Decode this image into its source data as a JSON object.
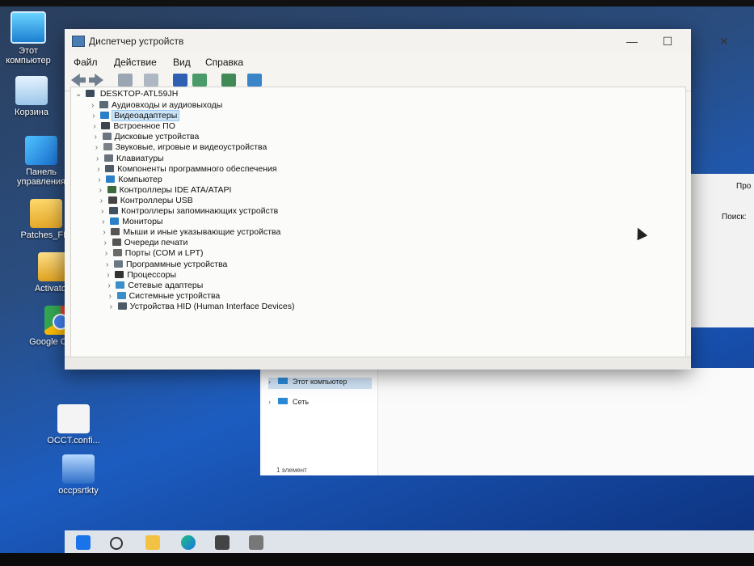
{
  "desktop": {
    "icons": [
      {
        "label": "Этот компьютер",
        "icon": "computer-icon"
      },
      {
        "label": "Корзина",
        "icon": "recycle-bin-icon"
      },
      {
        "label": "Панель управления",
        "icon": "control-panel-icon"
      },
      {
        "label": "Patches_FIX",
        "icon": "folder-icon"
      },
      {
        "label": "Activators",
        "icon": "key-icon"
      },
      {
        "label": "Google Chrome",
        "icon": "chrome-icon"
      },
      {
        "label": "OCCT.confi...",
        "icon": "document-icon"
      },
      {
        "label": "occpsrtkty",
        "icon": "occt-icon"
      }
    ]
  },
  "window": {
    "title": "Диспетчер устройств",
    "menu": [
      "Файл",
      "Действие",
      "Вид",
      "Справка"
    ],
    "controls": {
      "minimize": "—",
      "maximize": "☐",
      "close": "✕"
    },
    "toolbar": [
      "back-icon",
      "forward-icon",
      "properties-icon",
      "show-hidden-icon",
      "help-icon",
      "update-driver-icon",
      "scan-icon",
      "monitor-icon"
    ],
    "root": "DESKTOP-ATL59JH",
    "devices": [
      {
        "label": "Аудиовходы и аудиовыходы",
        "icon": "audio-icon"
      },
      {
        "label": "Видеоадаптеры",
        "icon": "display-adapter-icon",
        "selected": true
      },
      {
        "label": "Встроенное ПО",
        "icon": "firmware-icon"
      },
      {
        "label": "Дисковые устройства",
        "icon": "disk-icon"
      },
      {
        "label": "Звуковые, игровые и видеоустройства",
        "icon": "speaker-icon"
      },
      {
        "label": "Клавиатуры",
        "icon": "keyboard-icon"
      },
      {
        "label": "Компоненты программного обеспечения",
        "icon": "software-component-icon"
      },
      {
        "label": "Компьютер",
        "icon": "computer-icon"
      },
      {
        "label": "Контроллеры IDE ATA/ATAPI",
        "icon": "ide-controller-icon"
      },
      {
        "label": "Контроллеры USB",
        "icon": "usb-icon"
      },
      {
        "label": "Контроллеры запоминающих устройств",
        "icon": "storage-controller-icon"
      },
      {
        "label": "Мониторы",
        "icon": "monitor-icon"
      },
      {
        "label": "Мыши и иные указывающие устройства",
        "icon": "mouse-icon"
      },
      {
        "label": "Очереди печати",
        "icon": "printer-icon"
      },
      {
        "label": "Порты (COM и LPT)",
        "icon": "port-icon"
      },
      {
        "label": "Программные устройства",
        "icon": "software-device-icon"
      },
      {
        "label": "Процессоры",
        "icon": "processor-icon"
      },
      {
        "label": "Сетевые адаптеры",
        "icon": "network-adapter-icon"
      },
      {
        "label": "Системные устройства",
        "icon": "system-device-icon"
      },
      {
        "label": "Устройства HID (Human Interface Devices)",
        "icon": "hid-icon"
      }
    ]
  },
  "explorer": {
    "items": [
      {
        "label": "Этот компьютер",
        "icon": "computer-icon"
      },
      {
        "label": "Сеть",
        "icon": "network-icon"
      }
    ],
    "status": "1 элемент"
  },
  "side_panel": {
    "line1": "Про",
    "line2": "Поиск:"
  },
  "taskbar": [
    "start-icon",
    "search-icon",
    "file-explorer-icon",
    "edge-icon",
    "store-icon",
    "app-icon"
  ]
}
